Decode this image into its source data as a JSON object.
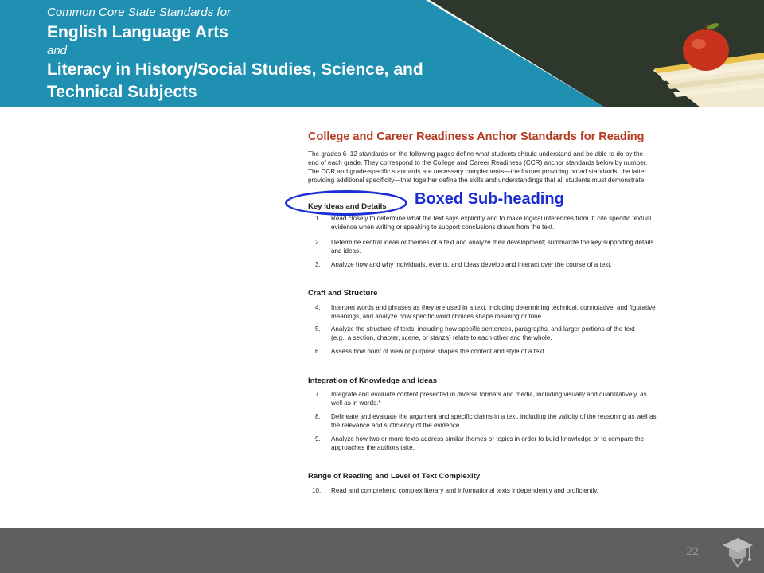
{
  "header": {
    "line1": "Common Core State Standards for",
    "line2": "English Language Arts",
    "line3": "and",
    "line4": "Literacy in History/Social Studies, Science, and",
    "line5": "Technical Subjects"
  },
  "document": {
    "title": "College and Career Readiness Anchor Standards for Reading",
    "intro": [
      "The grades 6–12 standards on the following pages define what students should understand and be able to do by the",
      "end of each grade. They correspond to the College and Career Readiness (CCR) anchor standards below by number.",
      "The CCR and grade-specific standards are necessary complements—the former providing broad standards, the latter",
      "providing additional specificity—that together define the skills and understandings that all students must demonstrate."
    ],
    "sections": [
      {
        "heading": "Key Ideas and Details",
        "items": [
          {
            "num": "1.",
            "lines": [
              "Read closely to determine what the text says explicitly and to make logical inferences from it; cite specific textual",
              "evidence when writing or speaking to support conclusions drawn from the text."
            ]
          },
          {
            "num": "2.",
            "lines": [
              "Determine central ideas or themes of a text and analyze their development; summarize the key supporting details",
              "and ideas."
            ]
          },
          {
            "num": "3.",
            "lines": [
              "Analyze how and why individuals, events, and ideas develop and interact over the course of a text."
            ]
          }
        ]
      },
      {
        "heading": "Craft and Structure",
        "items": [
          {
            "num": "4.",
            "lines": [
              "Interpret words and phrases as they are used in a text, including determining technical, connotative, and figurative",
              "meanings, and analyze how specific word choices shape meaning or tone."
            ]
          },
          {
            "num": "5.",
            "lines": [
              "Analyze the structure of texts, including how specific sentences, paragraphs, and larger portions of the text",
              "(e.g., a section, chapter, scene, or stanza) relate to each other and the whole."
            ]
          },
          {
            "num": "6.",
            "lines": [
              "Assess how point of view or purpose shapes the content and style of a text."
            ]
          }
        ]
      },
      {
        "heading": "Integration of Knowledge and Ideas",
        "items": [
          {
            "num": "7.",
            "lines": [
              "Integrate and evaluate content presented in diverse formats and media, including visually and quantitatively, as",
              "well as in words.*"
            ]
          },
          {
            "num": "8.",
            "lines": [
              "Delineate and evaluate the argument and specific claims in a text, including the validity of the reasoning as well as",
              "the relevance and sufficiency of the evidence."
            ]
          },
          {
            "num": "9.",
            "lines": [
              "Analyze how two or more texts address similar themes or topics in order to build knowledge or to compare the",
              "approaches the authors take."
            ]
          }
        ]
      },
      {
        "heading": "Range of Reading and Level of Text Complexity",
        "items": [
          {
            "num": "10.",
            "lines": [
              "Read and comprehend complex literary and informational texts independently and proficiently."
            ]
          }
        ]
      }
    ]
  },
  "callout": {
    "label": "Boxed Sub-heading"
  },
  "footer": {
    "page_number": "22"
  },
  "colors": {
    "banner": "#1f8fb2",
    "title": "#b53a1f",
    "callout": "#1b2fd6",
    "footer": "#5f5f5f"
  },
  "icons": [
    "apple-image",
    "books-image",
    "graduation-cap-icon"
  ]
}
